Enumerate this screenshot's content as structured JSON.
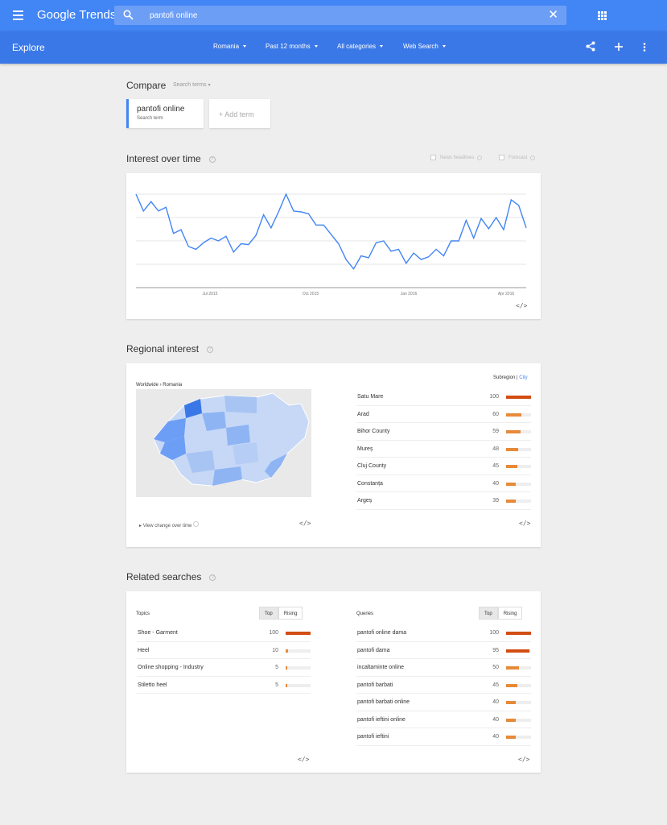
{
  "topbar": {
    "brand": "Google Trends",
    "search_value": "pantofi online",
    "clear": "✕"
  },
  "explore": {
    "title": "Explore",
    "filters": [
      "Romania",
      "Past 12 months",
      "All categories",
      "Web Search"
    ]
  },
  "compare": {
    "label": "Compare",
    "sub": "Search terms",
    "term_name": "pantofi online",
    "term_sub": "Search term",
    "add_term": "+ Add term"
  },
  "interest": {
    "title": "Interest over time",
    "opt_news": "News headlines",
    "opt_forecast": "Forecast",
    "embed": "</>"
  },
  "chart_data": {
    "type": "line",
    "x_ticks": [
      "Jul 2015",
      "Oct 2015",
      "Jan 2016",
      "Apr 2016"
    ],
    "values": [
      100,
      82,
      92,
      82,
      86,
      58,
      62,
      44,
      41,
      48,
      53,
      50,
      55,
      38,
      47,
      46,
      56,
      78,
      64,
      81,
      100,
      82,
      81,
      79,
      67,
      67,
      57,
      47,
      30,
      20,
      34,
      32,
      48,
      50,
      39,
      41,
      26,
      37,
      30,
      33,
      41,
      34,
      50,
      50,
      72,
      53,
      74,
      63,
      75,
      62,
      94,
      88,
      64
    ],
    "ylim": [
      0,
      100
    ],
    "grid": true
  },
  "regional": {
    "title": "Regional interest",
    "breadcrumb": "Worldwide › Romania",
    "toggle_sub": "Subregion",
    "toggle_city": "City",
    "view_change": "View change over time",
    "embed": "</>",
    "rows": [
      {
        "name": "Satu Mare",
        "value": "100",
        "pct": 100
      },
      {
        "name": "Arad",
        "value": "60",
        "pct": 60
      },
      {
        "name": "Bihor County",
        "value": "59",
        "pct": 59
      },
      {
        "name": "Mureș",
        "value": "48",
        "pct": 48
      },
      {
        "name": "Cluj County",
        "value": "45",
        "pct": 45
      },
      {
        "name": "Constanța",
        "value": "40",
        "pct": 40
      },
      {
        "name": "Argeș",
        "value": "39",
        "pct": 39
      }
    ]
  },
  "related": {
    "title": "Related searches",
    "topics_label": "Topics",
    "queries_label": "Queries",
    "tab_top": "Top",
    "tab_rising": "Rising",
    "embed": "</>",
    "topics": [
      {
        "name": "Shoe - Garment",
        "value": "100",
        "pct": 100
      },
      {
        "name": "Heel",
        "value": "10",
        "pct": 10
      },
      {
        "name": "Online shopping - Industry",
        "value": "5",
        "pct": 5
      },
      {
        "name": "Stiletto heel",
        "value": "5",
        "pct": 5
      }
    ],
    "queries": [
      {
        "name": "pantofi online dama",
        "value": "100",
        "pct": 100
      },
      {
        "name": "pantofi dama",
        "value": "95",
        "pct": 95
      },
      {
        "name": "incaltaminte online",
        "value": "50",
        "pct": 50
      },
      {
        "name": "pantofi barbati",
        "value": "45",
        "pct": 45
      },
      {
        "name": "pantofi barbati online",
        "value": "40",
        "pct": 40
      },
      {
        "name": "pantofi ieftini online",
        "value": "40",
        "pct": 40
      },
      {
        "name": "pantofi ieftini",
        "value": "40",
        "pct": 40
      }
    ]
  }
}
